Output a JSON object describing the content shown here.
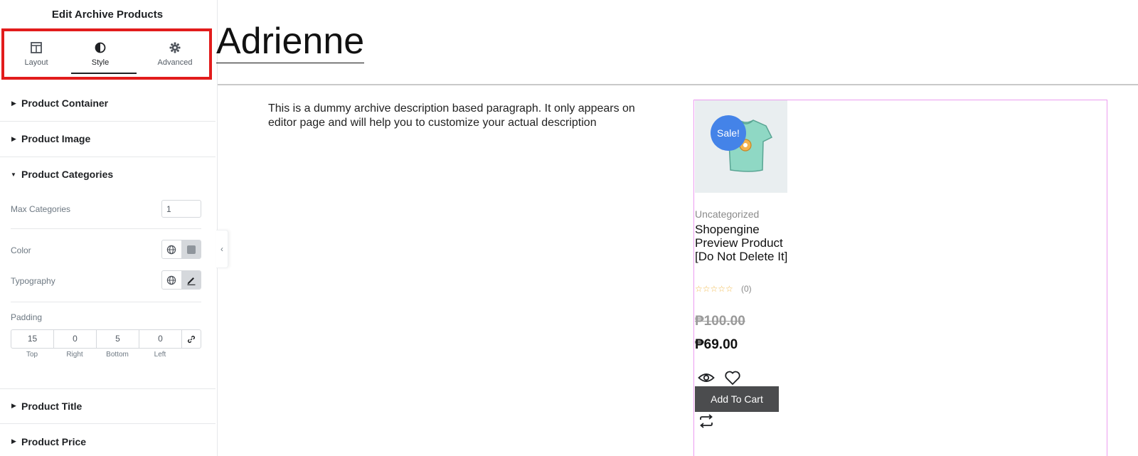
{
  "panel": {
    "title": "Edit Archive Products",
    "tabs": [
      {
        "label": "Layout",
        "icon": "layout-columns-icon"
      },
      {
        "label": "Style",
        "icon": "half-circle-contrast-icon",
        "active": true
      },
      {
        "label": "Advanced",
        "icon": "gear-icon"
      }
    ],
    "sections": {
      "product_container": "Product Container",
      "product_image": "Product Image",
      "product_categories": "Product Categories",
      "product_title": "Product Title",
      "product_price": "Product Price"
    },
    "controls": {
      "max_categories_label": "Max Categories",
      "max_categories_value": "1",
      "color_label": "Color",
      "typography_label": "Typography",
      "padding_label": "Padding",
      "padding": {
        "top": "15",
        "right": "0",
        "bottom": "5",
        "left": "0",
        "top_label": "Top",
        "right_label": "Right",
        "bottom_label": "Bottom",
        "left_label": "Left"
      }
    },
    "highlight_color": "#e21c1c"
  },
  "preview": {
    "archive_title": "Adrienne",
    "description": "This is a dummy archive description based paragraph. It only appears on editor page and will help you to customize your actual description",
    "product": {
      "sale_badge": "Sale!",
      "category": "Uncategorized",
      "title": "Shopengine Preview Product [Do Not Delete It]",
      "stars": "☆☆☆☆☆",
      "rating_count": "(0)",
      "old_price": "₱100.00",
      "new_price": "₱69.00",
      "add_to_cart": "Add To Cart",
      "sale_badge_color": "#4483e8",
      "box_outline_color": "#ec9cf0"
    }
  }
}
